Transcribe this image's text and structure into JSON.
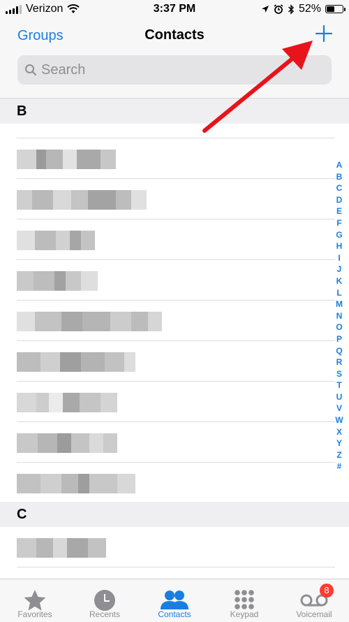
{
  "status_bar": {
    "carrier": "Verizon",
    "time": "3:37 PM",
    "battery_percent": "52%",
    "battery_level": 0.52,
    "icons": [
      "wifi-icon",
      "location-icon",
      "alarm-icon",
      "bluetooth-icon"
    ]
  },
  "nav": {
    "groups_label": "Groups",
    "title": "Contacts",
    "add_icon": "plus-icon"
  },
  "search": {
    "placeholder": "Search"
  },
  "sections": [
    {
      "letter": "B"
    },
    {
      "letter": "C"
    }
  ],
  "index_letters": [
    "A",
    "B",
    "C",
    "D",
    "E",
    "F",
    "G",
    "H",
    "I",
    "J",
    "K",
    "L",
    "M",
    "N",
    "O",
    "P",
    "Q",
    "R",
    "S",
    "T",
    "U",
    "V",
    "W",
    "X",
    "Y",
    "Z",
    "#"
  ],
  "tabs": [
    {
      "label": "Favorites",
      "icon": "star-icon",
      "active": false
    },
    {
      "label": "Recents",
      "icon": "clock-icon",
      "active": false
    },
    {
      "label": "Contacts",
      "icon": "contacts-icon",
      "active": true
    },
    {
      "label": "Keypad",
      "icon": "keypad-icon",
      "active": false
    },
    {
      "label": "Voicemail",
      "icon": "voicemail-icon",
      "active": false,
      "badge": "8"
    }
  ],
  "colors": {
    "accent": "#1a7ee0",
    "annotation_arrow": "#e8141c",
    "badge": "#ff3b30"
  }
}
